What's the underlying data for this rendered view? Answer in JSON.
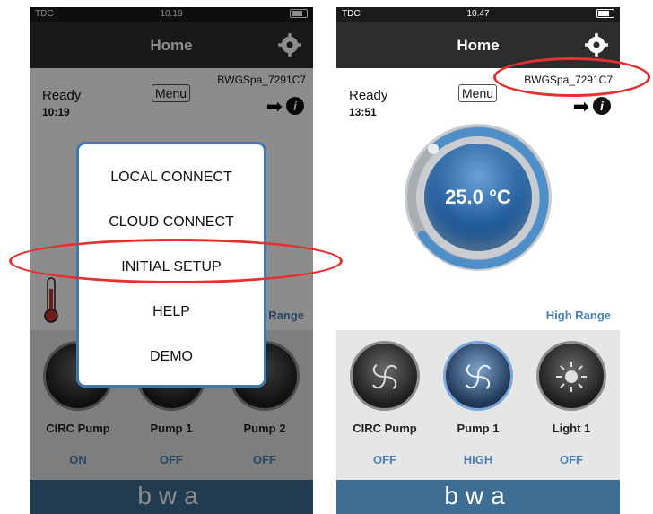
{
  "left_phone": {
    "status": {
      "carrier": "TDC",
      "time": "10.19"
    },
    "nav_title": "Home",
    "device_id": "BWGSpa_7291C7",
    "ready_label": "Ready",
    "ready_time": "10:19",
    "menu_label": "Menu",
    "range_label": "Range",
    "popup": {
      "items": [
        "LOCAL CONNECT",
        "CLOUD CONNECT",
        "INITIAL SETUP",
        "HELP",
        "DEMO"
      ]
    },
    "pumps": [
      {
        "name": "CIRC Pump",
        "state": "ON"
      },
      {
        "name": "Pump 1",
        "state": "OFF"
      },
      {
        "name": "Pump 2",
        "state": "OFF"
      }
    ],
    "footer_logo": "bwa"
  },
  "right_phone": {
    "status": {
      "carrier": "TDC",
      "time": "10.47"
    },
    "nav_title": "Home",
    "device_id": "BWGSpa_7291C7",
    "ready_label": "Ready",
    "ready_time": "13:51",
    "menu_label": "Menu",
    "temperature": "25.0 °C",
    "range_label": "High Range",
    "pumps": [
      {
        "name": "CIRC Pump",
        "state": "OFF"
      },
      {
        "name": "Pump 1",
        "state": "HIGH"
      },
      {
        "name": "Light 1",
        "state": "OFF"
      }
    ],
    "footer_logo": "bwa"
  },
  "colors": {
    "accent_blue": "#4a7fb5",
    "highlight_red": "#e53030",
    "footer_blue": "#3d6d93",
    "nav_dark": "#2d2d2d"
  }
}
